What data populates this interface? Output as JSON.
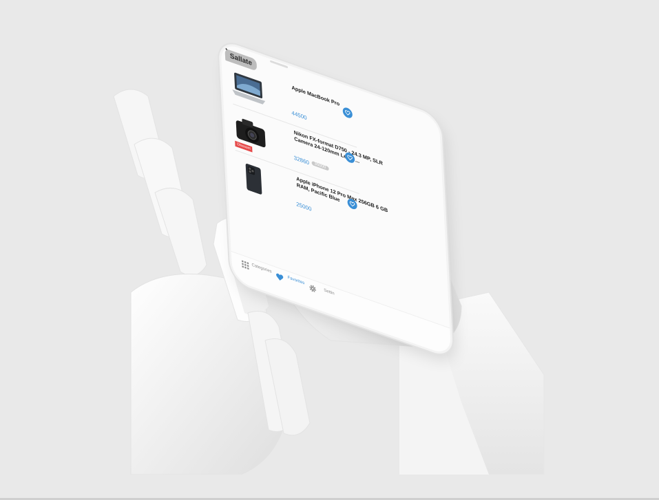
{
  "app": {
    "logo": "Sallate"
  },
  "products": [
    {
      "title": "Apple MacBook Pro",
      "price": "44500",
      "old_price": "",
      "badge": ""
    },
    {
      "title": "Nikon FX-format D750 - 24.3 MP, SLR Camera 24-120mm Lens, ...",
      "price": "32860",
      "old_price": "35000",
      "badge": "Discount"
    },
    {
      "title": "Apple iPhone 12 Pro Max 256GB 6 GB RAM, Pacific Blue",
      "price": "25000",
      "old_price": "",
      "badge": ""
    }
  ],
  "tabs": [
    {
      "label": "Categories",
      "icon": "grid-icon"
    },
    {
      "label": "Favorites",
      "icon": "heart-icon"
    },
    {
      "label": "Settin",
      "icon": "gear-icon"
    }
  ],
  "colors": {
    "accent": "#3a8fd6",
    "badge": "#e64a4a",
    "background": "#e9e9e9"
  }
}
